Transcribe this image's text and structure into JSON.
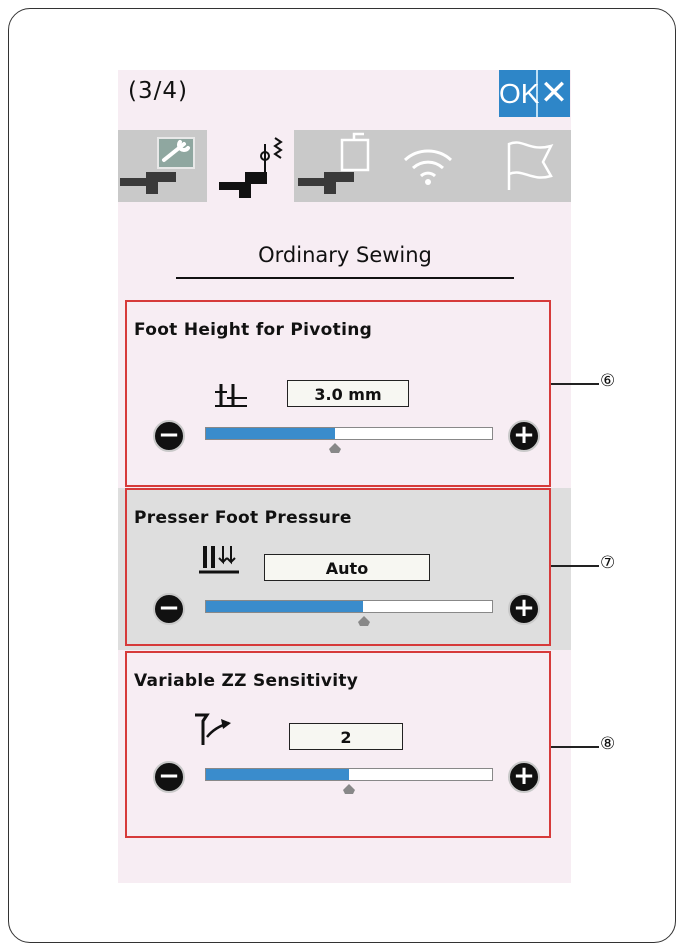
{
  "header": {
    "page_indicator": "(3/4)",
    "ok_label": "OK",
    "close_label": "✕"
  },
  "tabs": [
    {
      "name": "settings",
      "icon": "wrench-machine-icon",
      "active": false
    },
    {
      "name": "sewing",
      "icon": "needle-zigzag-machine-icon",
      "active": true
    },
    {
      "name": "embroidery",
      "icon": "hoop-machine-icon",
      "active": false
    },
    {
      "name": "wireless",
      "icon": "wifi-icon",
      "active": false
    },
    {
      "name": "language",
      "icon": "flag-icon",
      "active": false
    }
  ],
  "section_title": "Ordinary Sewing",
  "settings": [
    {
      "title": "Foot Height for Pivoting",
      "icon": "pivot-foot-height-icon",
      "value": "3.0 mm",
      "level": 0.45,
      "callout": "⑥"
    },
    {
      "title": "Presser Foot Pressure",
      "icon": "foot-pressure-icon",
      "value": "Auto",
      "level": 0.55,
      "callout": "⑦"
    },
    {
      "title": "Variable ZZ Sensitivity",
      "icon": "knee-lever-icon",
      "value": "2",
      "level": 0.5,
      "callout": "⑧"
    }
  ],
  "colors": {
    "accent": "#2e86c8",
    "panel_border": "#d63a3a",
    "screen_bg": "#f7edf3",
    "tab_bg": "#c9c9c9"
  }
}
